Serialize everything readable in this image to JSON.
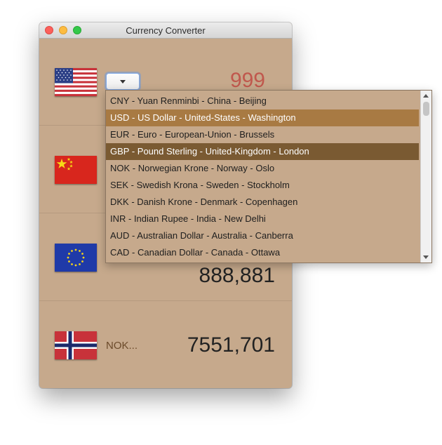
{
  "window": {
    "title": "Currency Converter"
  },
  "rows": [
    {
      "flag": "us-flag-icon",
      "amount": "999",
      "amount_color": "#c0584d"
    },
    {
      "flag": "china-flag-icon",
      "amount": ""
    },
    {
      "flag": "eu-flag-icon",
      "amount": "888,881"
    },
    {
      "flag": "norway-flag-icon",
      "code_label": "NOK...",
      "amount": "7551,701"
    }
  ],
  "dropdown": {
    "options": [
      "CNY - Yuan Renminbi - China - Beijing",
      "USD - US Dollar - United-States - Washington",
      "EUR - Euro - European-Union - Brussels",
      "GBP - Pound Sterling - United-Kingdom - London",
      "NOK - Norwegian Krone - Norway - Oslo",
      "SEK - Swedish Krona - Sweden - Stockholm",
      "DKK - Danish Krone - Denmark - Copenhagen",
      "INR - Indian Rupee - India - New Delhi",
      "AUD - Australian Dollar - Australia - Canberra",
      "CAD - Canadian Dollar - Canada - Ottawa"
    ],
    "selected_index": 1,
    "highlighted_index": 3
  },
  "colors": {
    "window_bg": "#c6a98c",
    "selected_bg": "#a87a43",
    "highlight_bg": "#7a5a32"
  }
}
